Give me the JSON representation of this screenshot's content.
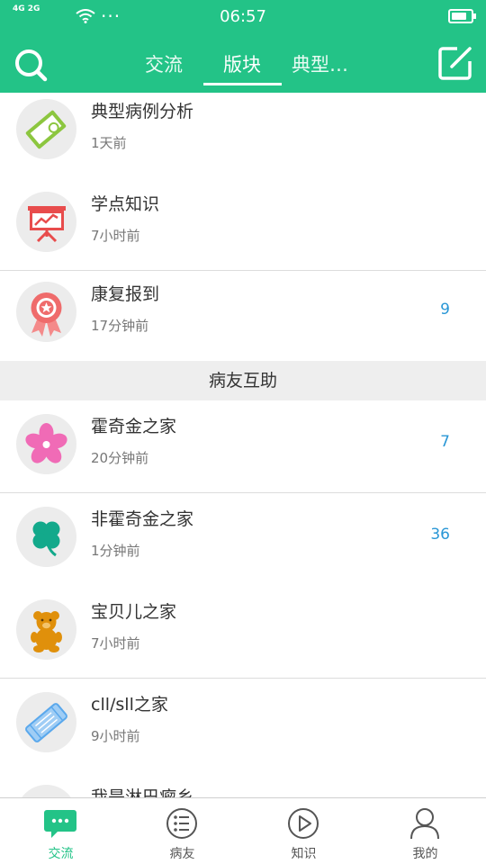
{
  "status_bar": {
    "network": "4G 2G",
    "time": "06:57",
    "more": "···",
    "battery_level": 0.8
  },
  "header": {
    "tabs": [
      {
        "label": "交流",
        "active": false
      },
      {
        "label": "版块",
        "active": true
      },
      {
        "label": "典型…",
        "active": false
      }
    ],
    "search_icon": "search-icon",
    "compose_icon": "compose-icon",
    "accent_color": "#23c387"
  },
  "boards": [
    {
      "title": "典型病例分析",
      "time": "1天前",
      "count": "",
      "icon": "case-analysis-icon"
    },
    {
      "title": "学点知识",
      "time": "7小时前",
      "count": "",
      "icon": "presentation-icon"
    },
    {
      "title": "康复报到",
      "time": "17分钟前",
      "count": "9",
      "icon": "rosette-icon"
    }
  ],
  "section_label": "病友互助",
  "groups": [
    {
      "title": "霍奇金之家",
      "time": "20分钟前",
      "count": "7",
      "icon": "flower-icon"
    },
    {
      "title": "非霍奇金之家",
      "time": "1分钟前",
      "count": "36",
      "icon": "clover-icon"
    },
    {
      "title": "宝贝儿之家",
      "time": "7小时前",
      "count": "",
      "icon": "teddy-bear-icon"
    },
    {
      "title": "cll/sll之家",
      "time": "9小时前",
      "count": "",
      "icon": "bandage-icon"
    },
    {
      "title": "我是淋巴瘤乡",
      "time": "",
      "count": "",
      "icon": "generic-board-icon"
    }
  ],
  "bottom_nav": [
    {
      "label": "交流",
      "icon": "chat-icon",
      "active": true
    },
    {
      "label": "病友",
      "icon": "list-icon",
      "active": false
    },
    {
      "label": "知识",
      "icon": "play-icon",
      "active": false
    },
    {
      "label": "我的",
      "icon": "profile-icon",
      "active": false
    }
  ],
  "count_color": "#2a97d6"
}
